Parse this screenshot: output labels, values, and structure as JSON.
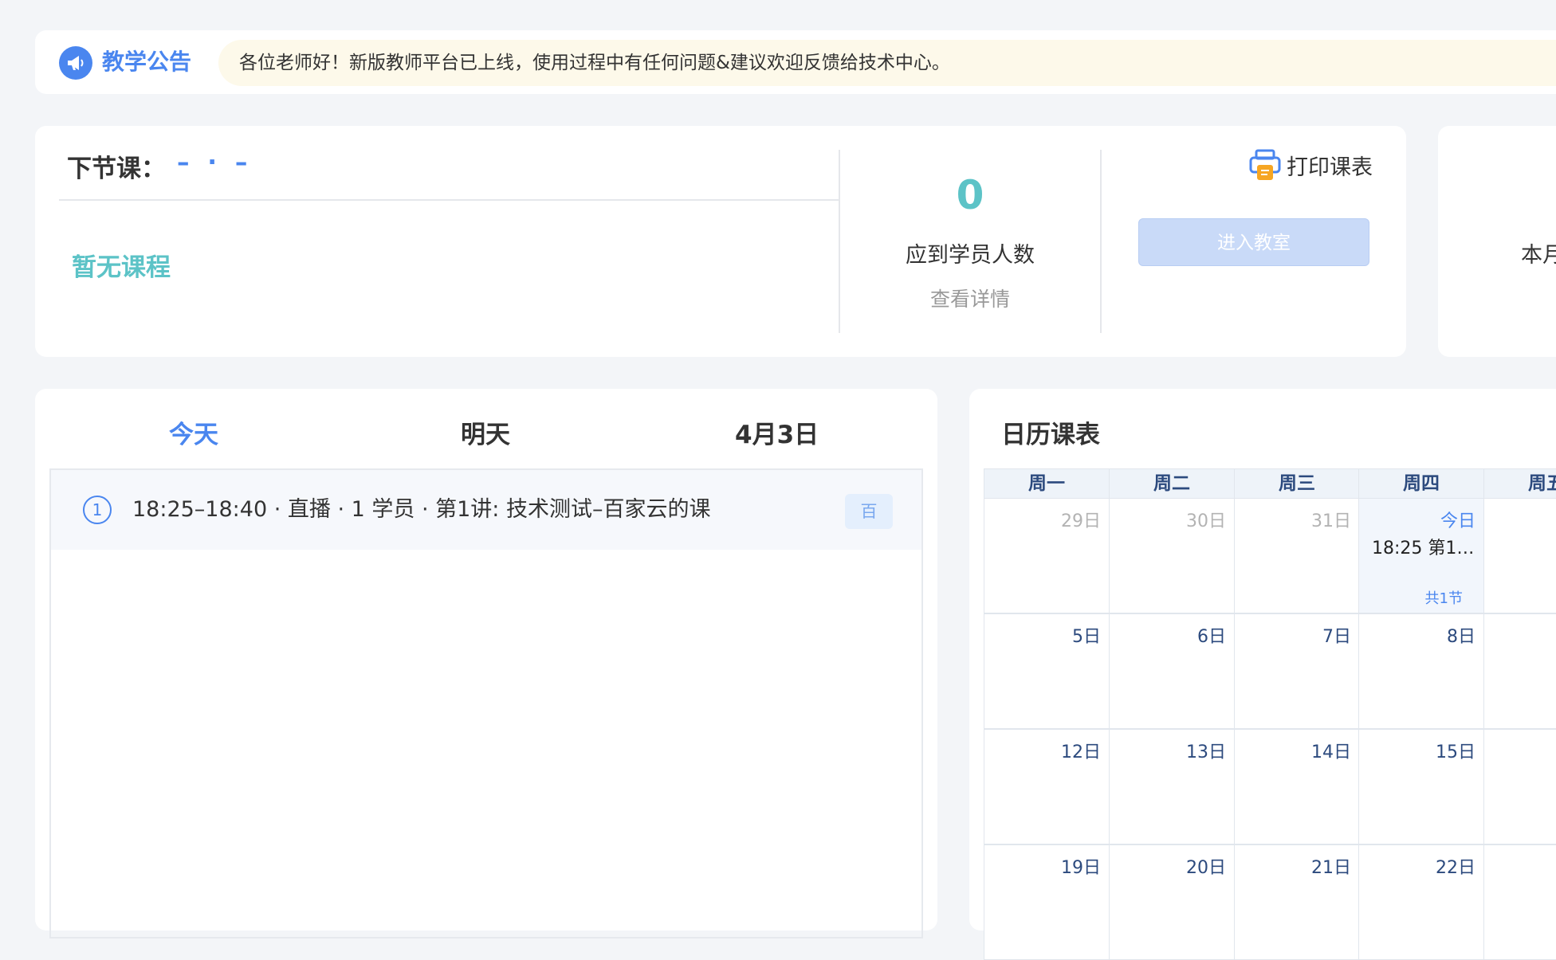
{
  "notice": {
    "icon": "megaphone-icon",
    "title": "教学公告",
    "message": "各位老师好！新版教师平台已上线，使用过程中有任何问题&建议欢迎反馈给技术中心。"
  },
  "next_lesson": {
    "label": "下节课：",
    "time_placeholder": "– · –",
    "empty_text": "暂无课程",
    "student_count": "0",
    "student_count_label": "应到学员人数",
    "details_link": "查看详情",
    "print_label": "打印课表",
    "enter_button": "进入教室"
  },
  "stats": {
    "label": "本月"
  },
  "schedule": {
    "tabs": [
      "今天",
      "明天",
      "4月3日"
    ],
    "active_tab": "今天",
    "items": [
      {
        "index": "1",
        "text": "18:25–18:40 · 直播 · 1 学员 · 第1讲: 技术测试–百家云的课",
        "tag": "百"
      }
    ]
  },
  "calendar": {
    "title": "日历课表",
    "weekdays": [
      "周一",
      "周二",
      "周三",
      "周四",
      "周五"
    ],
    "weeks": [
      [
        {
          "label": "29日",
          "muted": true
        },
        {
          "label": "30日",
          "muted": true
        },
        {
          "label": "31日",
          "muted": true
        },
        {
          "label": "今日",
          "today": true,
          "event": "18:25 第1…",
          "total": "共1节"
        },
        {
          "label": ""
        }
      ],
      [
        {
          "label": "5日"
        },
        {
          "label": "6日"
        },
        {
          "label": "7日"
        },
        {
          "label": "8日"
        },
        {
          "label": ""
        }
      ],
      [
        {
          "label": "12日"
        },
        {
          "label": "13日"
        },
        {
          "label": "14日"
        },
        {
          "label": "15日"
        },
        {
          "label": ""
        }
      ],
      [
        {
          "label": "19日"
        },
        {
          "label": "20日"
        },
        {
          "label": "21日"
        },
        {
          "label": "22日"
        },
        {
          "label": ""
        }
      ]
    ]
  },
  "colors": {
    "accent": "#4a86ef",
    "teal": "#5cc3c7",
    "notice_bg": "#fdf9ea"
  }
}
